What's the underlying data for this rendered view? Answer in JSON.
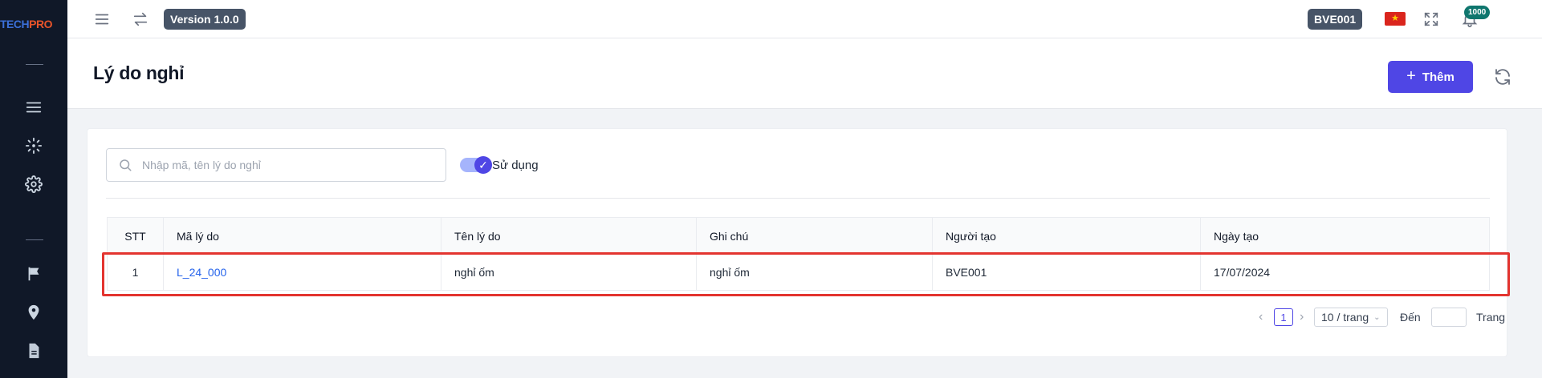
{
  "sidebar": {
    "logo_part1": "TECH",
    "logo_part2": "PRO",
    "icons": [
      "menu-icon",
      "scan-icon",
      "gear-icon",
      "flag-icon",
      "location-pin-icon",
      "document-icon"
    ]
  },
  "topbar": {
    "version": "Version 1.0.0",
    "user_code": "BVE001",
    "flag_star": "★",
    "notification_count": "1000"
  },
  "page": {
    "title": "Lý do nghỉ",
    "add_label": "Thêm"
  },
  "filters": {
    "search_placeholder": "Nhập mã, tên lý do nghỉ",
    "search_value": "",
    "toggle_label": "Sử dụng",
    "toggle_checked": true,
    "check_mark": "✓"
  },
  "table": {
    "columns": [
      "STT",
      "Mã lý do",
      "Tên lý do",
      "Ghi chú",
      "Người tạo",
      "Ngày tạo"
    ],
    "rows": [
      {
        "stt": "1",
        "code": "L_24_000",
        "name": "nghỉ ốm",
        "note": "nghỉ ốm",
        "creator": "BVE001",
        "created_date": "17/07/2024"
      }
    ]
  },
  "pagination": {
    "prev": "‹",
    "current_page": "1",
    "next": "›",
    "page_size": "10 / trang",
    "page_size_chevron": "⌄",
    "goto_label": "Đến",
    "page_label": "Trang"
  },
  "colors": {
    "sidebar_bg": "#101828",
    "primary": "#4f46e5",
    "link": "#2563eb",
    "highlight": "#e3342f"
  }
}
